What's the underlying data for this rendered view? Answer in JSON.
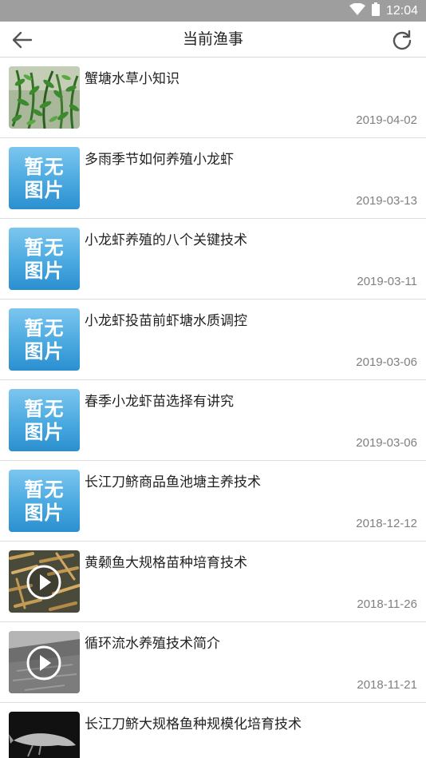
{
  "status_bar": {
    "time": "12:04"
  },
  "appbar": {
    "title": "当前渔事"
  },
  "placeholder": {
    "line1": "暂无",
    "line2": "图片"
  },
  "items": [
    {
      "title": "蟹塘水草小知识",
      "date": "2019-04-02",
      "thumb": "photo-water-plants"
    },
    {
      "title": "多雨季节如何养殖小龙虾",
      "date": "2019-03-13",
      "thumb": "no-image"
    },
    {
      "title": "小龙虾养殖的八个关键技术",
      "date": "2019-03-11",
      "thumb": "no-image"
    },
    {
      "title": "小龙虾投苗前虾塘水质调控",
      "date": "2019-03-06",
      "thumb": "no-image"
    },
    {
      "title": "春季小龙虾苗选择有讲究",
      "date": "2019-03-06",
      "thumb": "no-image"
    },
    {
      "title": "长江刀鲚商品鱼池塘主养技术",
      "date": "2018-12-12",
      "thumb": "no-image"
    },
    {
      "title": "黄颡鱼大规格苗种培育技术",
      "date": "2018-11-26",
      "thumb": "video-fish"
    },
    {
      "title": "循环流水养殖技术简介",
      "date": "2018-11-21",
      "thumb": "video-pond"
    },
    {
      "title": "长江刀鲚大规格鱼种规模化培育技术",
      "date": "",
      "thumb": "photo-fish-dark"
    }
  ]
}
